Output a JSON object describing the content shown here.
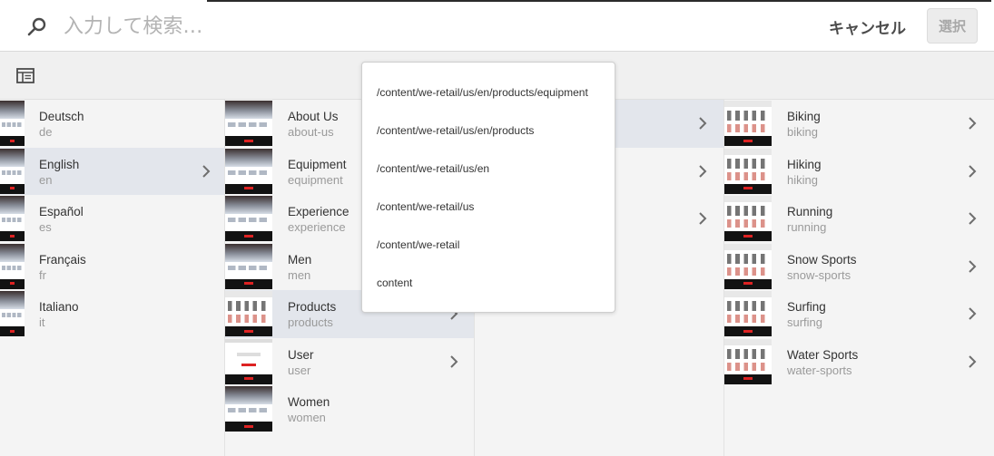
{
  "search": {
    "placeholder": "入力して検索…",
    "value": ""
  },
  "header": {
    "cancel_label": "キャンセル",
    "select_label": "選択"
  },
  "icons": {
    "search": "search-icon",
    "rail": "rail-toggle-icon",
    "chevron": "chevron-right-icon"
  },
  "colors": {
    "selected_row": "#e3e6ec",
    "background": "#f4f4f4"
  },
  "path_popover": {
    "items": [
      "/content/we-retail/us/en/products/equipment",
      "/content/we-retail/us/en/products",
      "/content/we-retail/us/en",
      "/content/we-retail/us",
      "/content/we-retail",
      "content"
    ]
  },
  "columns": [
    {
      "items": [
        {
          "title": "Deutsch",
          "name": "de",
          "selected": false,
          "has_children": false
        },
        {
          "title": "English",
          "name": "en",
          "selected": true,
          "has_children": true
        },
        {
          "title": "Español",
          "name": "es",
          "selected": false,
          "has_children": false
        },
        {
          "title": "Français",
          "name": "fr",
          "selected": false,
          "has_children": false
        },
        {
          "title": "Italiano",
          "name": "it",
          "selected": false,
          "has_children": false
        }
      ]
    },
    {
      "items": [
        {
          "title": "About Us",
          "name": "about-us",
          "selected": false,
          "has_children": false
        },
        {
          "title": "Equipment",
          "name": "equipment",
          "selected": false,
          "has_children": false
        },
        {
          "title": "Experience",
          "name": "experience",
          "selected": false,
          "has_children": false
        },
        {
          "title": "Men",
          "name": "men",
          "selected": false,
          "has_children": false
        },
        {
          "title": "Products",
          "name": "products",
          "selected": true,
          "has_children": true
        },
        {
          "title": "User",
          "name": "user",
          "selected": false,
          "has_children": true
        },
        {
          "title": "Women",
          "name": "women",
          "selected": false,
          "has_children": false
        }
      ]
    },
    {
      "items": [
        {
          "selected": true,
          "has_children": true
        },
        {
          "selected": false,
          "has_children": true
        },
        {
          "selected": false,
          "has_children": true
        }
      ]
    },
    {
      "items": [
        {
          "title": "Biking",
          "name": "biking",
          "selected": false,
          "has_children": true
        },
        {
          "title": "Hiking",
          "name": "hiking",
          "selected": false,
          "has_children": true
        },
        {
          "title": "Running",
          "name": "running",
          "selected": false,
          "has_children": true
        },
        {
          "title": "Snow Sports",
          "name": "snow-sports",
          "selected": false,
          "has_children": true
        },
        {
          "title": "Surfing",
          "name": "surfing",
          "selected": false,
          "has_children": true
        },
        {
          "title": "Water Sports",
          "name": "water-sports",
          "selected": false,
          "has_children": true
        }
      ]
    }
  ]
}
